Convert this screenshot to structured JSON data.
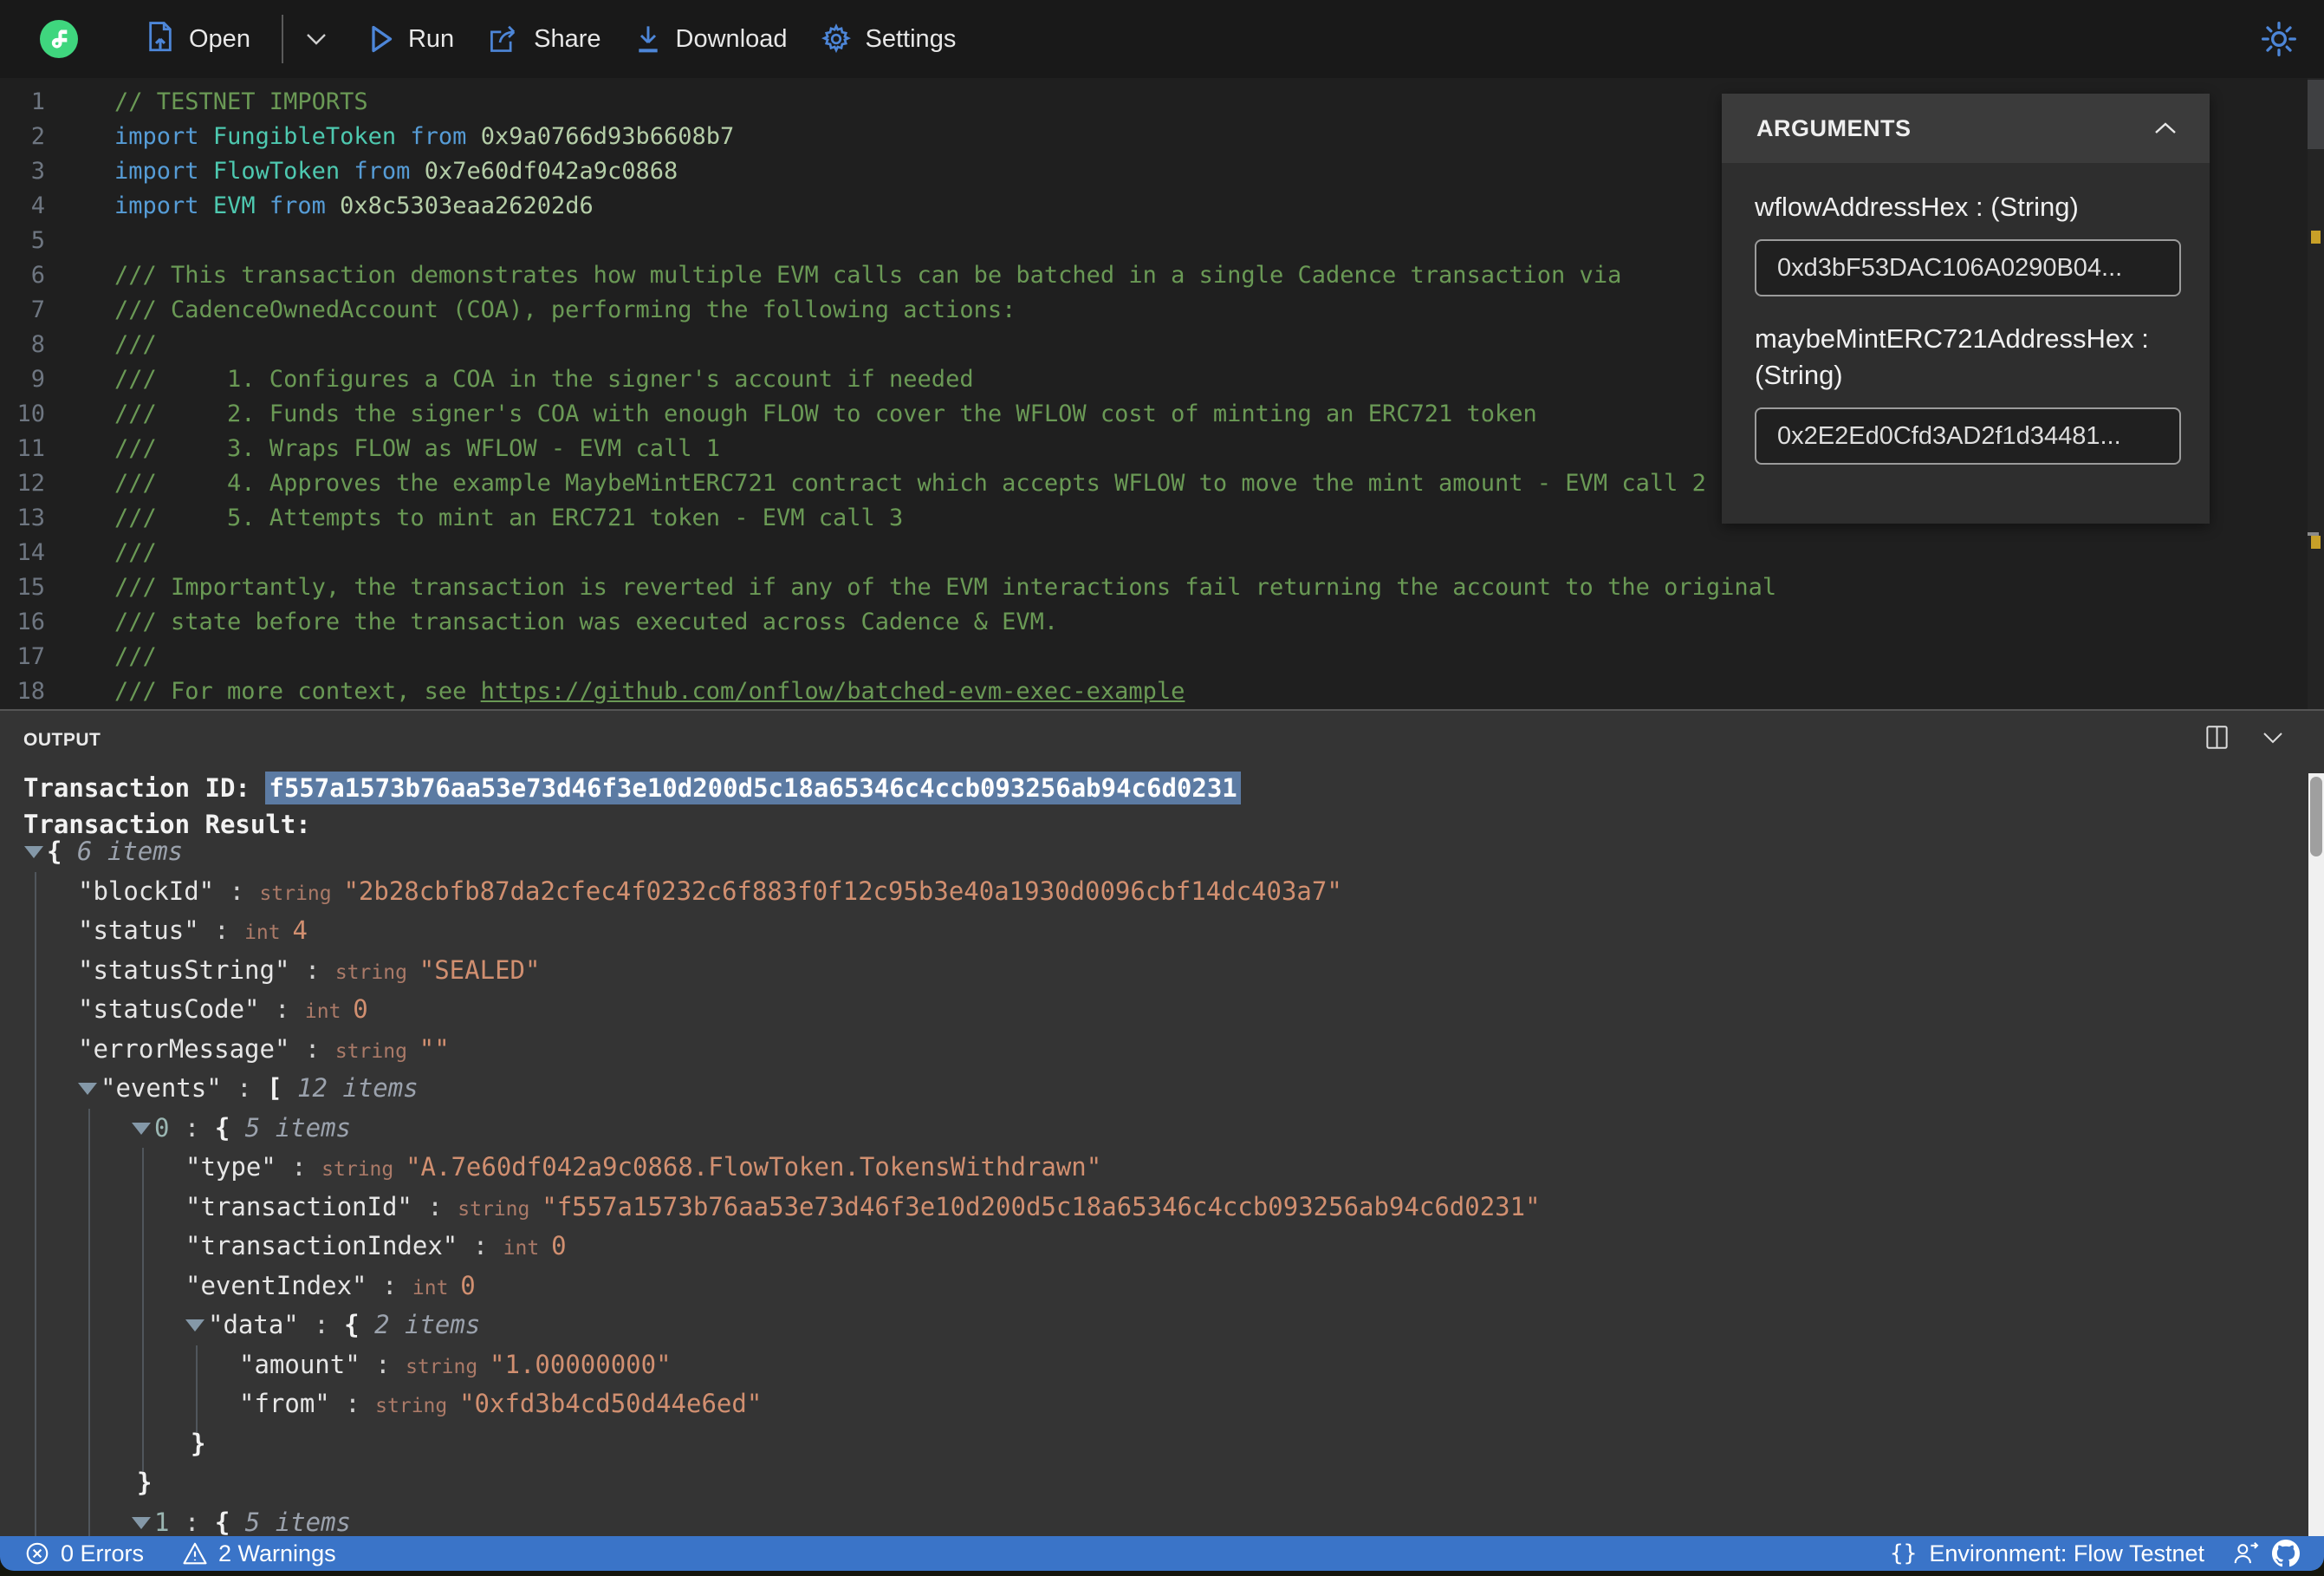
{
  "toolbar": {
    "open_label": "Open",
    "run_label": "Run",
    "share_label": "Share",
    "download_label": "Download",
    "settings_label": "Settings"
  },
  "arguments_panel": {
    "title": "ARGUMENTS",
    "fields": [
      {
        "label": "wflowAddressHex : (String)",
        "value": "0xd3bF53DAC106A0290B04..."
      },
      {
        "label": "maybeMintERC721AddressHex : (String)",
        "value": "0x2E2Ed0Cfd3AD2f1d34481..."
      }
    ]
  },
  "editor": {
    "lines": [
      {
        "n": 1,
        "tokens": [
          [
            "cm",
            "// TESTNET IMPORTS"
          ]
        ]
      },
      {
        "n": 2,
        "tokens": [
          [
            "kw",
            "import"
          ],
          [
            "pl",
            " "
          ],
          [
            "ty",
            "FungibleToken"
          ],
          [
            "pl",
            " "
          ],
          [
            "kw",
            "from"
          ],
          [
            "pl",
            " "
          ],
          [
            "num",
            "0x9a0766d93b6608b7"
          ]
        ]
      },
      {
        "n": 3,
        "tokens": [
          [
            "kw",
            "import"
          ],
          [
            "pl",
            " "
          ],
          [
            "ty",
            "FlowToken"
          ],
          [
            "pl",
            " "
          ],
          [
            "kw",
            "from"
          ],
          [
            "pl",
            " "
          ],
          [
            "num",
            "0x7e60df042a9c0868"
          ]
        ]
      },
      {
        "n": 4,
        "tokens": [
          [
            "kw",
            "import"
          ],
          [
            "pl",
            " "
          ],
          [
            "ty",
            "EVM"
          ],
          [
            "pl",
            " "
          ],
          [
            "kw",
            "from"
          ],
          [
            "pl",
            " "
          ],
          [
            "num",
            "0x8c5303eaa26202d6"
          ]
        ]
      },
      {
        "n": 5,
        "tokens": []
      },
      {
        "n": 6,
        "tokens": [
          [
            "cm",
            "/// This transaction demonstrates how multiple EVM calls can be batched in a single Cadence transaction via"
          ]
        ]
      },
      {
        "n": 7,
        "tokens": [
          [
            "cm",
            "/// CadenceOwnedAccount (COA), performing the following actions:"
          ]
        ]
      },
      {
        "n": 8,
        "tokens": [
          [
            "cm",
            "///"
          ]
        ]
      },
      {
        "n": 9,
        "tokens": [
          [
            "cm",
            "///     1. Configures a COA in the signer's account if needed"
          ]
        ]
      },
      {
        "n": 10,
        "tokens": [
          [
            "cm",
            "///     2. Funds the signer's COA with enough FLOW to cover the WFLOW cost of minting an ERC721 token"
          ]
        ]
      },
      {
        "n": 11,
        "tokens": [
          [
            "cm",
            "///     3. Wraps FLOW as WFLOW - EVM call 1"
          ]
        ]
      },
      {
        "n": 12,
        "tokens": [
          [
            "cm",
            "///     4. Approves the example MaybeMintERC721 contract which accepts WFLOW to move the mint amount - EVM call 2"
          ]
        ]
      },
      {
        "n": 13,
        "tokens": [
          [
            "cm",
            "///     5. Attempts to mint an ERC721 token - EVM call 3"
          ]
        ]
      },
      {
        "n": 14,
        "tokens": [
          [
            "cm",
            "///"
          ]
        ]
      },
      {
        "n": 15,
        "tokens": [
          [
            "cm",
            "/// Importantly, the transaction is reverted if any of the EVM interactions fail returning the account to the original"
          ]
        ]
      },
      {
        "n": 16,
        "tokens": [
          [
            "cm",
            "/// state before the transaction was executed across Cadence & EVM."
          ]
        ]
      },
      {
        "n": 17,
        "tokens": [
          [
            "cm",
            "///"
          ]
        ]
      },
      {
        "n": 18,
        "tokens": [
          [
            "cm",
            "/// For more context, see "
          ],
          [
            "lk",
            "https://github.com/onflow/batched-evm-exec-example"
          ]
        ]
      }
    ]
  },
  "output": {
    "title": "OUTPUT",
    "transaction_id_label": "Transaction ID: ",
    "transaction_id": "f557a1573b76aa53e73d46f3e10d200d5c18a65346c4ccb093256ab94c6d0231",
    "transaction_result_label": "Transaction Result:",
    "tree": {
      "rows": [
        {
          "indent": 0,
          "arrow": true,
          "open": "{",
          "items": "6 items"
        },
        {
          "indent": 1,
          "key": "blockId",
          "type": "string",
          "value": "2b28cbfb87da2cfec4f0232c6f883f0f12c95b3e40a1930d0096cbf14dc403a7"
        },
        {
          "indent": 1,
          "key": "status",
          "type": "int",
          "value": "4"
        },
        {
          "indent": 1,
          "key": "statusString",
          "type": "string",
          "value": "SEALED"
        },
        {
          "indent": 1,
          "key": "statusCode",
          "type": "int",
          "value": "0"
        },
        {
          "indent": 1,
          "key": "errorMessage",
          "type": "string",
          "value": ""
        },
        {
          "indent": 1,
          "arrow": true,
          "key": "events",
          "open": "[",
          "items": "12 items"
        },
        {
          "indent": 2,
          "arrow": true,
          "index": "0",
          "open": "{",
          "items": "5 items"
        },
        {
          "indent": 3,
          "key": "type",
          "type": "string",
          "value": "A.7e60df042a9c0868.FlowToken.TokensWithdrawn"
        },
        {
          "indent": 3,
          "key": "transactionId",
          "type": "string",
          "value": "f557a1573b76aa53e73d46f3e10d200d5c18a65346c4ccb093256ab94c6d0231"
        },
        {
          "indent": 3,
          "key": "transactionIndex",
          "type": "int",
          "value": "0"
        },
        {
          "indent": 3,
          "key": "eventIndex",
          "type": "int",
          "value": "0"
        },
        {
          "indent": 3,
          "arrow": true,
          "key": "data",
          "open": "{",
          "items": "2 items"
        },
        {
          "indent": 4,
          "key": "amount",
          "type": "string",
          "value": "1.00000000"
        },
        {
          "indent": 4,
          "key": "from",
          "type": "string",
          "value": "0xfd3b4cd50d44e6ed"
        },
        {
          "indent": 3,
          "close": "}"
        },
        {
          "indent": 2,
          "close": "}"
        },
        {
          "indent": 2,
          "arrow": true,
          "index": "1",
          "open": "{",
          "items": "5 items"
        }
      ]
    }
  },
  "statusbar": {
    "errors_label": "0 Errors",
    "warnings_label": "2 Warnings",
    "environment_label": "Environment: Flow Testnet",
    "braces_glyph": "{}"
  },
  "colors": {
    "accent_blue": "#4d86d8",
    "flow_green": "#3fd67e",
    "statusbar_blue": "#3a74c8",
    "comment_green": "#6A9955",
    "keyword_blue": "#569CD6",
    "type_teal": "#4EC9B0",
    "number_green": "#B5CEA8",
    "json_value_orange": "#d18f70",
    "selection_blue": "#5c7ba3",
    "warning_yellow": "#c8a028"
  }
}
